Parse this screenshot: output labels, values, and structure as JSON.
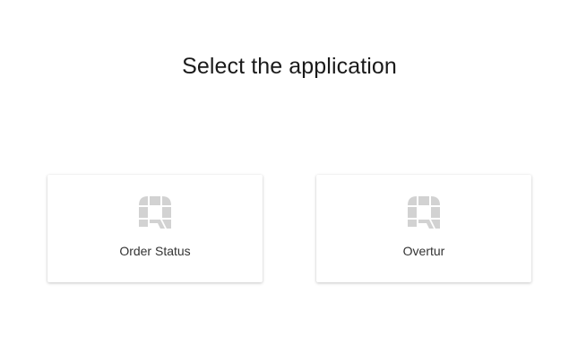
{
  "page": {
    "title": "Select the application"
  },
  "applications": [
    {
      "label": "Order Status",
      "icon": "app-logo-icon"
    },
    {
      "label": "Overtur",
      "icon": "app-logo-icon"
    }
  ],
  "colors": {
    "icon_gray": "#d2d2d2",
    "title_text": "#1a1a1a",
    "label_text": "#333333"
  }
}
